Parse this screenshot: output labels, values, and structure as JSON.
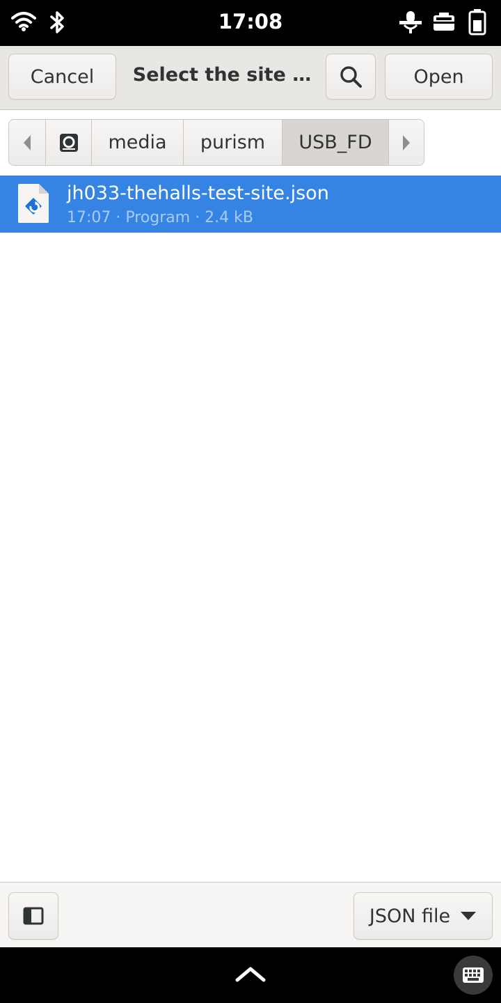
{
  "status_bar": {
    "time": "17:08",
    "icons": [
      "wifi-icon",
      "bluetooth-icon",
      "microphone-muted-icon",
      "camera-muted-icon",
      "battery-icon"
    ]
  },
  "header": {
    "cancel_label": "Cancel",
    "title": "Select the site …",
    "search_icon": "search-icon",
    "open_label": "Open"
  },
  "pathbar": {
    "back_icon": "chevron-left-icon",
    "root_icon": "drive-icon",
    "segments": [
      "media",
      "purism",
      "USB_FD"
    ],
    "forward_icon": "chevron-right-icon"
  },
  "files": [
    {
      "name": "jh033-thehalls-test-site.json",
      "meta": "17:07 · Program · 2.4 kB",
      "icon": "script-file-icon",
      "selected": true
    }
  ],
  "actionbar": {
    "sidebar_toggle_icon": "sidebar-toggle-icon",
    "filter_label": "JSON file",
    "filter_icon": "dropdown-arrow-icon"
  },
  "gesture_bar": {
    "home_icon": "chevron-up-icon",
    "keyboard_icon": "keyboard-icon"
  },
  "colors": {
    "selection": "#3584e4",
    "header_bg": "#e9e7e4",
    "status_bg": "#000000"
  }
}
